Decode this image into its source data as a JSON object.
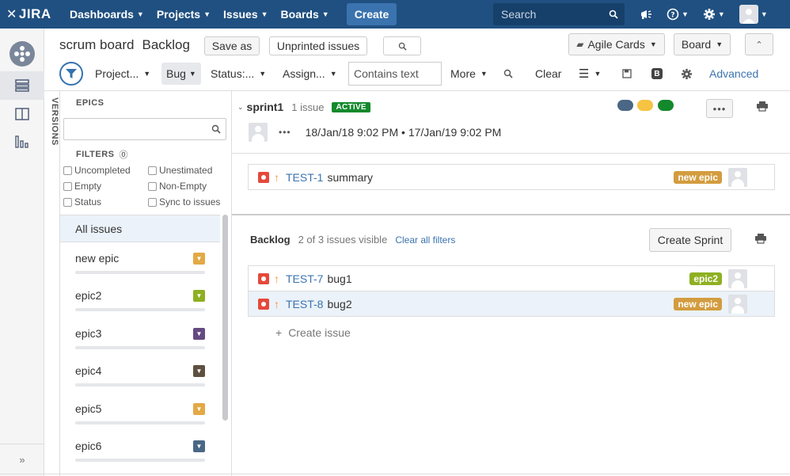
{
  "topnav": {
    "logo_text": "JIRA",
    "items": [
      {
        "label": "Dashboards"
      },
      {
        "label": "Projects"
      },
      {
        "label": "Issues"
      },
      {
        "label": "Boards"
      }
    ],
    "create_label": "Create",
    "search_placeholder": "Search",
    "bg_color": "#205081"
  },
  "header": {
    "board_name": "scrum board",
    "view_name": "Backlog",
    "save_as": "Save as",
    "unprinted": "Unprinted issues",
    "agile_cards": "Agile Cards",
    "board": "Board"
  },
  "filterbar": {
    "project": "Project...",
    "bug": "Bug",
    "status": "Status:...",
    "assignee": "Assign...",
    "contains_placeholder": "Contains text",
    "more": "More",
    "clear": "Clear",
    "bold_icon": "B",
    "advanced": "Advanced"
  },
  "sidebar": {
    "versions_label": "VERSIONS",
    "epics_label": "EPICS",
    "filters_label": "FILTERS",
    "filters": [
      {
        "label": "Uncompleted"
      },
      {
        "label": "Unestimated"
      },
      {
        "label": "Empty"
      },
      {
        "label": "Non-Empty"
      },
      {
        "label": "Status"
      },
      {
        "label": "Sync to issues"
      }
    ],
    "all_issues": "All issues",
    "epics": [
      {
        "name": "new epic",
        "color": "#e3a945"
      },
      {
        "name": "epic2",
        "color": "#8eb021"
      },
      {
        "name": "epic3",
        "color": "#654982"
      },
      {
        "name": "epic4",
        "color": "#5e503f"
      },
      {
        "name": "epic5",
        "color": "#e3a945"
      },
      {
        "name": "epic6",
        "color": "#4a6785"
      }
    ]
  },
  "sprint": {
    "name": "sprint1",
    "count": "1 issue",
    "status": "ACTIVE",
    "more": "•••",
    "dates": "18/Jan/18 9:02 PM • 17/Jan/19 9:02 PM",
    "dot_colors": [
      "#4a6785",
      "#f6c342",
      "#14892c"
    ],
    "issues": [
      {
        "key": "TEST-1",
        "summary": "summary",
        "epic": "new epic",
        "epic_color": "#d39c3f"
      }
    ]
  },
  "backlog": {
    "name": "Backlog",
    "count": "2 of 3 issues visible",
    "clear_filters": "Clear all filters",
    "create_sprint": "Create Sprint",
    "issues": [
      {
        "key": "TEST-7",
        "summary": "bug1",
        "epic": "epic2",
        "epic_color": "#8eb021"
      },
      {
        "key": "TEST-8",
        "summary": "bug2",
        "epic": "new epic",
        "epic_color": "#d39c3f"
      }
    ],
    "create_issue": "Create issue"
  }
}
